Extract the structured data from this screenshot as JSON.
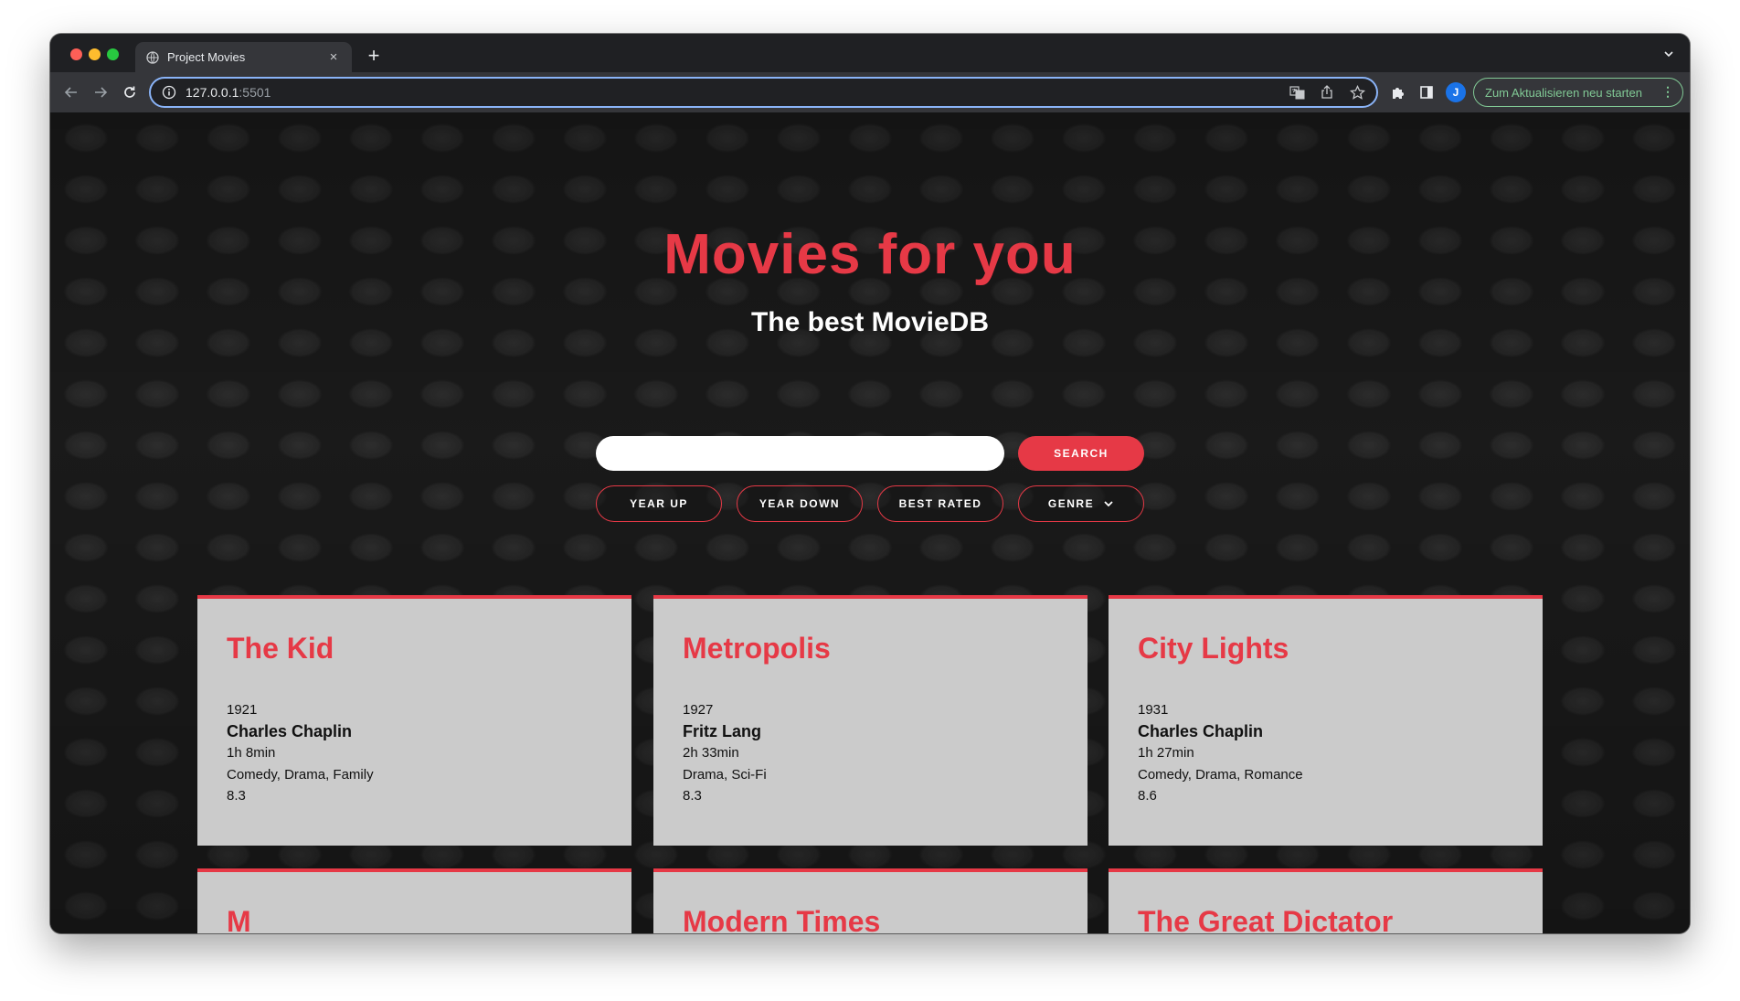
{
  "browser": {
    "tab_title": "Project Movies",
    "tab_close": "×",
    "new_tab": "+",
    "url_host": "127.0.0.1",
    "url_port": ":5501",
    "profile_initial": "J",
    "update_button_label": "Zum Aktualisieren neu starten",
    "update_menu": "⋮"
  },
  "hero": {
    "title": "Movies for you",
    "subtitle": "The best MovieDB"
  },
  "search": {
    "value": "",
    "button_label": "SEARCH"
  },
  "filters": {
    "year_up": "YEAR UP",
    "year_down": "YEAR DOWN",
    "best_rated": "BEST RATED",
    "genre": "GENRE"
  },
  "movies": [
    {
      "title": "The Kid",
      "year": "1921",
      "director": "Charles Chaplin",
      "duration": "1h 8min",
      "genres": "Comedy, Drama, Family",
      "rating": "8.3"
    },
    {
      "title": "Metropolis",
      "year": "1927",
      "director": "Fritz Lang",
      "duration": "2h 33min",
      "genres": "Drama, Sci-Fi",
      "rating": "8.3"
    },
    {
      "title": "City Lights",
      "year": "1931",
      "director": "Charles Chaplin",
      "duration": "1h 27min",
      "genres": "Comedy, Drama, Romance",
      "rating": "8.6"
    },
    {
      "title": "M"
    },
    {
      "title": "Modern Times"
    },
    {
      "title": "The Great Dictator"
    }
  ],
  "colors": {
    "accent": "#e63946",
    "card_bg": "#cbcbcb",
    "page_bg": "#1b1b1b"
  }
}
